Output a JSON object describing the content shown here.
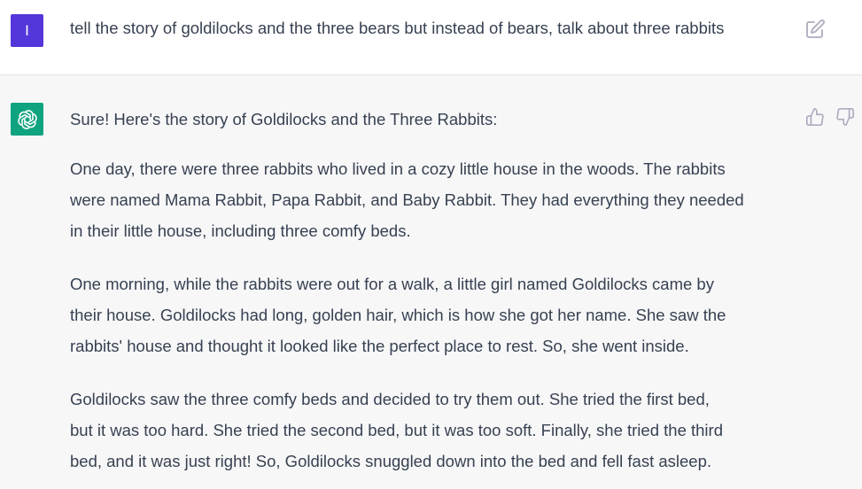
{
  "user_message": {
    "avatar_letter": "I",
    "text": "tell the story of goldilocks and the three bears but instead of bears, talk about three rabbits",
    "avatar_color": "#5436da"
  },
  "assistant_message": {
    "avatar_color": "#10a37f",
    "intro": "Sure! Here's the story of Goldilocks and the Three Rabbits:",
    "paragraphs": [
      {
        "lines": [
          "One day, there were three rabbits who lived in a cozy little house in the woods. The rabbits",
          "were named Mama Rabbit, Papa Rabbit, and Baby Rabbit. They had everything they needed",
          "in their little house, including three comfy beds."
        ]
      },
      {
        "lines": [
          "One morning, while the rabbits were out for a walk, a little girl named Goldilocks came by",
          "their house. Goldilocks had long, golden hair, which is how she got her name. She saw the",
          "rabbits' house and thought it looked like the perfect place to rest. So, she went inside."
        ]
      },
      {
        "lines": [
          "Goldilocks saw the three comfy beds and decided to try them out. She tried the first bed,",
          "but it was too hard. She tried the second bed, but it was too soft. Finally, she tried the third",
          "bed, and it was just right! So, Goldilocks snuggled down into the bed and fell fast asleep."
        ]
      }
    ]
  },
  "icons": {
    "edit": "edit-icon",
    "thumbs_up": "thumbs-up-icon",
    "thumbs_down": "thumbs-down-icon",
    "bot_logo": "openai-logo-icon"
  }
}
